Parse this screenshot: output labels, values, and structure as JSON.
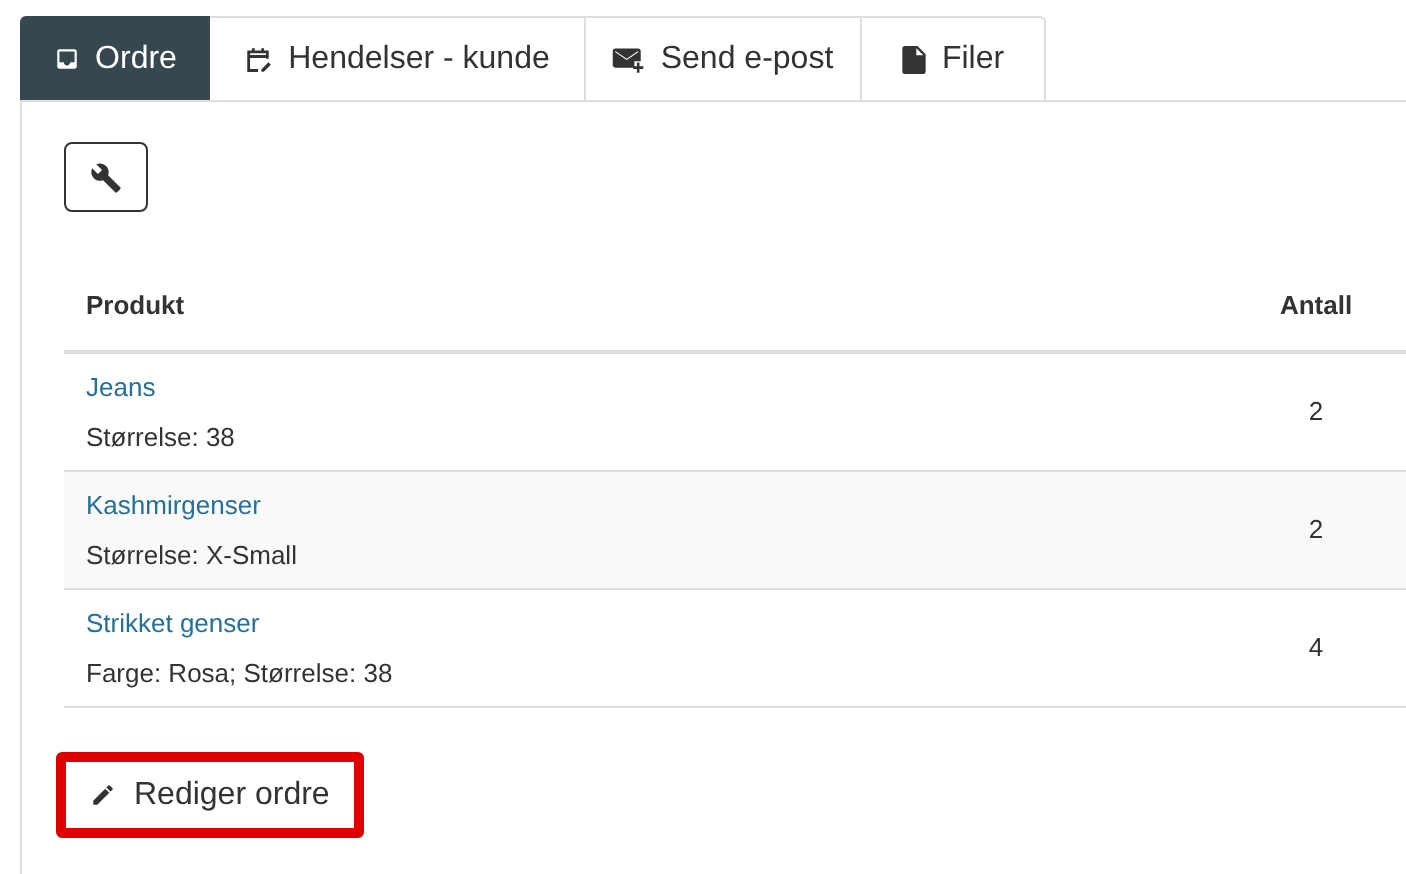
{
  "tabs": [
    {
      "label": "Ordre",
      "selected": true
    },
    {
      "label": "Hendelser - kunde",
      "selected": false
    },
    {
      "label": "Send e-post",
      "selected": false
    },
    {
      "label": "Filer",
      "selected": false
    }
  ],
  "table": {
    "columns": [
      "Produkt",
      "Antall"
    ],
    "rows": [
      {
        "product": "Jeans",
        "details": "Størrelse: 38",
        "quantity": "2"
      },
      {
        "product": "Kashmirgenser",
        "details": "Størrelse: X-Small",
        "quantity": "2"
      },
      {
        "product": "Strikket genser",
        "details": "Farge: Rosa; Størrelse: 38",
        "quantity": "4"
      }
    ]
  },
  "edit_button": {
    "label": "Rediger ordre",
    "highlighted": true
  }
}
